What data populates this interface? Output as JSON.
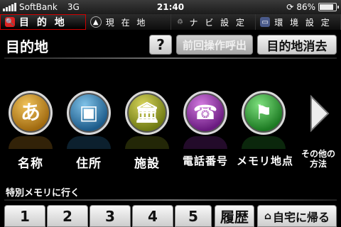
{
  "status_bar": {
    "carrier": "SoftBank",
    "network": "3G",
    "time": "21:40",
    "battery": "86%",
    "battery_level": 0.86
  },
  "tabs": [
    {
      "label": "目 的 地",
      "icon": "search-icon"
    },
    {
      "label": "現 在 地",
      "icon": "compass-icon"
    },
    {
      "label": "ナ ビ 設 定",
      "icon": "route-icon"
    },
    {
      "label": "環 境 設 定",
      "icon": "settings-card-icon"
    }
  ],
  "header": {
    "title": "目的地",
    "help_label": "?",
    "prev_label": "前回操作呼出",
    "clear_label": "目的地消去"
  },
  "categories": [
    {
      "glyph": "あ",
      "label": "名称",
      "icon": "kana-icon",
      "color": "#c8871e"
    },
    {
      "glyph": "▣",
      "label": "住所",
      "icon": "address-icon",
      "color": "#2f7fb6"
    },
    {
      "glyph": "🏛",
      "label": "施設",
      "icon": "facility-icon",
      "color": "#8b9a1c"
    },
    {
      "glyph": "☎",
      "label": "電話番号",
      "icon": "phone-icon",
      "color": "#8a2aa6"
    },
    {
      "glyph": "⚑",
      "label": "メモリ地点",
      "icon": "flag-icon",
      "color": "#2a9a30"
    }
  ],
  "more": {
    "label_line1": "その他の",
    "label_line2": "方法",
    "icon": "chevron-right-icon"
  },
  "memory": {
    "label": "特別メモリに行く",
    "slots": [
      "1",
      "2",
      "3",
      "4",
      "5"
    ],
    "history_label": "履歴",
    "home_label": "自宅に帰る"
  }
}
